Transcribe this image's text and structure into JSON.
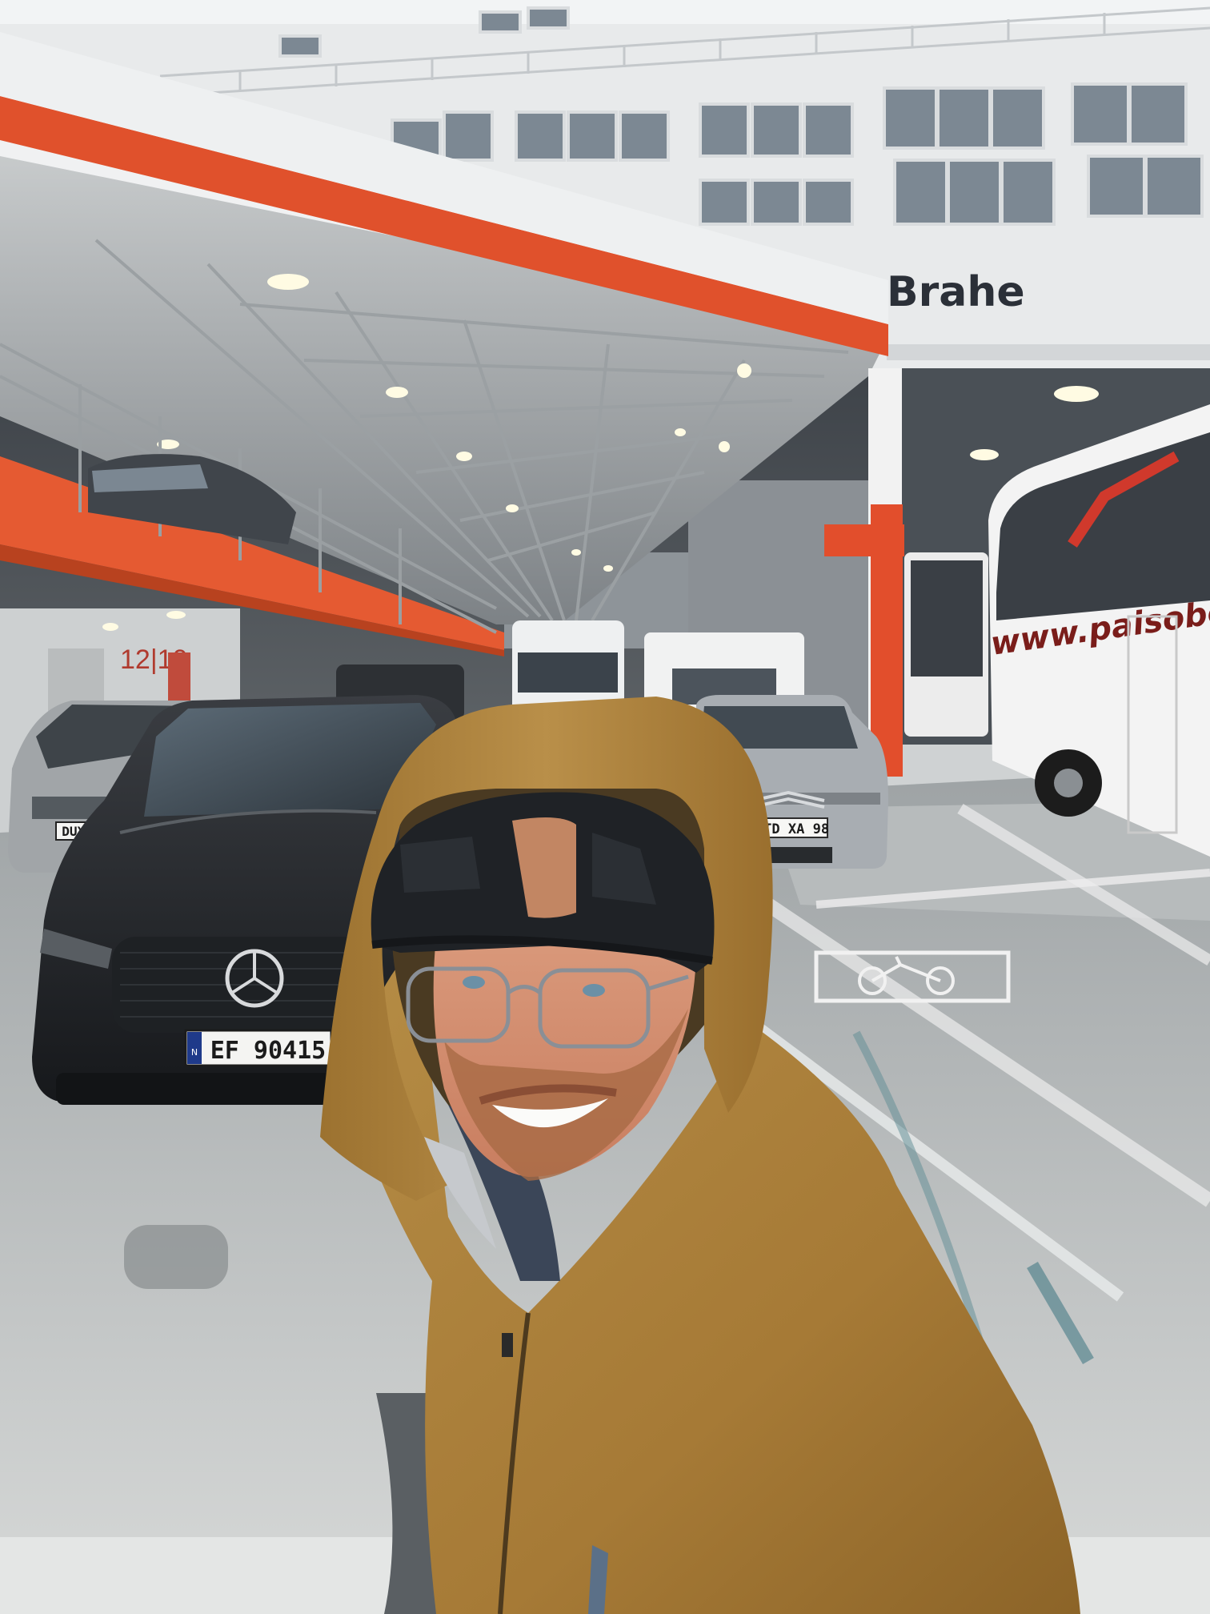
{
  "scene": {
    "ship_name": "Brahe",
    "deck_sign": "12|10",
    "bus_website": "www.paisobolewski.pl",
    "plates": {
      "mercedes": "EF 90415",
      "mercedes_country": "N",
      "citroen": "STD XA 98",
      "volvo": "DUX 720"
    }
  }
}
